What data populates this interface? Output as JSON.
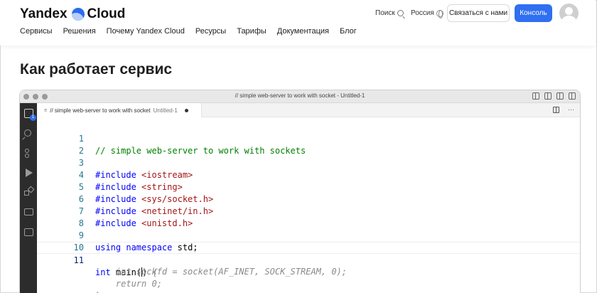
{
  "header": {
    "brand_left": "Yandex",
    "brand_right": "Cloud",
    "nav": [
      "Сервисы",
      "Решения",
      "Почему Yandex Cloud",
      "Ресурсы",
      "Тарифы",
      "Документация",
      "Блог"
    ],
    "search_label": "Поиск",
    "region_label": "Россия",
    "contact_button": "Связаться с нами",
    "console_button": "Консоль"
  },
  "page": {
    "title": "Как работает сервис"
  },
  "editor": {
    "window_title": "// simple web-server to work with socket - Untitled-1",
    "tab_label": "// simple web-server to work with socket",
    "tab_file": "Untitled-1",
    "files_badge": "1",
    "lines": [
      {
        "n": "1",
        "text": "// simple web-server to work with sockets"
      },
      {
        "n": "2",
        "text": ""
      },
      {
        "n": "3",
        "kw": "#include",
        "arg": "<iostream>"
      },
      {
        "n": "4",
        "kw": "#include",
        "arg": "<string>"
      },
      {
        "n": "5",
        "kw": "#include",
        "arg": "<sys/socket.h>"
      },
      {
        "n": "6",
        "kw": "#include",
        "arg": "<netinet/in.h>"
      },
      {
        "n": "7",
        "kw": "#include",
        "arg": "<unistd.h>"
      },
      {
        "n": "8",
        "text": ""
      },
      {
        "n": "9",
        "kw1": "using",
        "kw2": "namespace",
        "rest": " std;"
      },
      {
        "n": "10",
        "text": ""
      },
      {
        "n": "11",
        "kw": "int",
        "code": " main(",
        "close": ")",
        "ghost": " {"
      }
    ],
    "ghost_lines": [
      "    int sockfd = socket(AF_INET, SOCK_STREAM, 0);",
      "    return 0;",
      "}"
    ]
  }
}
